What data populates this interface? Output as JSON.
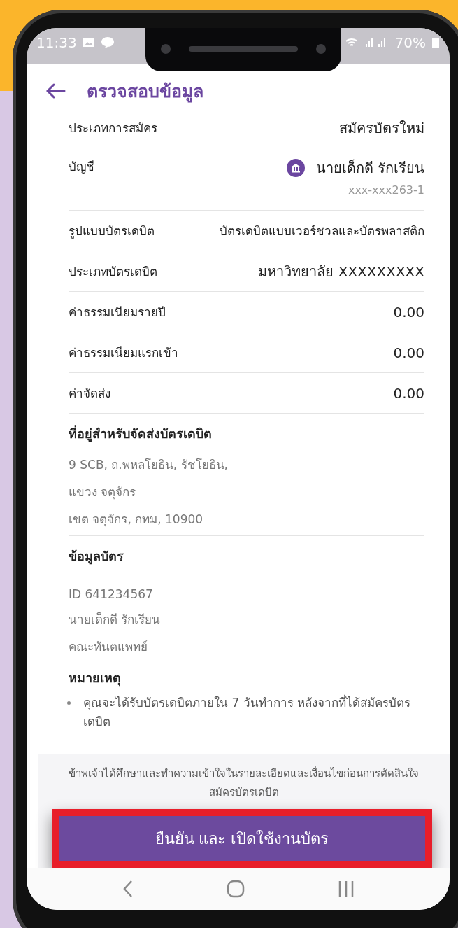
{
  "status_bar": {
    "time": "11:33",
    "battery": "70%"
  },
  "header": {
    "title": "ตรวจสอบข้อมูล"
  },
  "rows": [
    {
      "kind": "text",
      "label": "ประเภทการสมัคร",
      "value": "สมัครบัตรใหม่"
    },
    {
      "kind": "account",
      "label": "บัญชี",
      "value": "นายเด็กดี  รักเรียน",
      "sub": "xxx-xxx263-1"
    },
    {
      "kind": "text",
      "label": "รูปแบบบัตรเดบิต",
      "value": "บัตรเดบิตแบบเวอร์ชวลและบัตรพลาสติก"
    },
    {
      "kind": "text",
      "label": "ประเภทบัตรเดบิต",
      "value": "มหาวิทยาลัย XXXXXXXXX"
    },
    {
      "kind": "text",
      "label": "ค่าธรรมเนียมรายปี",
      "value": "0.00"
    },
    {
      "kind": "text",
      "label": "ค่าธรรมเนียมแรกเข้า",
      "value": "0.00"
    },
    {
      "kind": "text",
      "label": "ค่าจัดส่ง",
      "value": "0.00"
    }
  ],
  "address": {
    "title": "ที่อยู่สำหรับจัดส่งบัตรเดบิต",
    "lines": [
      "9 SCB, ถ.พหลโยธิน, รัชโยธิน,",
      "แขวง จตุจักร",
      "เขต จตุจักร, กทม, 10900"
    ]
  },
  "card_info": {
    "title": "ข้อมูลบัตร",
    "lines": [
      "ID 641234567",
      "นายเด็กดี  รักเรียน",
      "คณะทันตแพทย์"
    ]
  },
  "note": {
    "title": "หมายเหตุ",
    "items": [
      "คุณจะได้รับบัตรเดบิตภายใน 7 วันทำการ หลังจากที่ได้สมัครบัตรเดบิต"
    ]
  },
  "disclaimer": "ข้าพเจ้าได้ศึกษาและทำความเข้าใจในรายละเอียดและเงื่อนไขก่อนการตัดสินใจสมัครบัตรเดบิต",
  "confirm_button": {
    "label": "ยืนยัน และ เปิดใช้งานบัตร"
  }
}
